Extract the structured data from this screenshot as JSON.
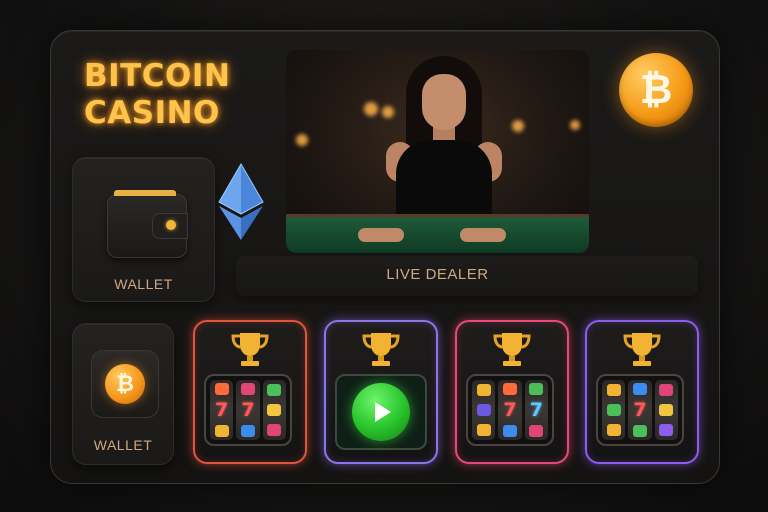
{
  "brand": {
    "title_line1": "BITCOIN",
    "title_line2": "CASINO"
  },
  "wallet_panels": [
    {
      "label": "WALLET"
    },
    {
      "label": "WALLET"
    }
  ],
  "live_dealer": {
    "label": "LIVE DEALER"
  },
  "icons": {
    "bitcoin_symbol": "₿",
    "ethereum": "ethereum-icon",
    "wallet": "wallet-icon",
    "trophy": "trophy-icon",
    "play": "play-icon"
  },
  "slot_reels": {
    "card_1": [
      [
        "heart",
        "bar",
        "shield"
      ],
      [
        "7",
        "7",
        "bell"
      ],
      [
        "crown",
        "diamond",
        "gem"
      ]
    ],
    "card_3": [
      [
        "shield",
        "bar",
        "shield"
      ],
      [
        "x",
        "7",
        "7"
      ],
      [
        "crown",
        "diamond",
        "gem"
      ]
    ],
    "card_4": [
      [
        "shield",
        "bar",
        "gem"
      ],
      [
        "shield",
        "7",
        "bell"
      ],
      [
        "crown",
        "diamond",
        "gem"
      ]
    ]
  },
  "colors": {
    "title": "#ffc24a",
    "bitcoin": "#f59a16",
    "card_1_border": "#e0563d",
    "card_2_border": "#8a77e6",
    "card_3_border": "#e9487a",
    "card_4_border": "#8f5cf0",
    "play": "#28c22b",
    "label": "#cfa880"
  }
}
